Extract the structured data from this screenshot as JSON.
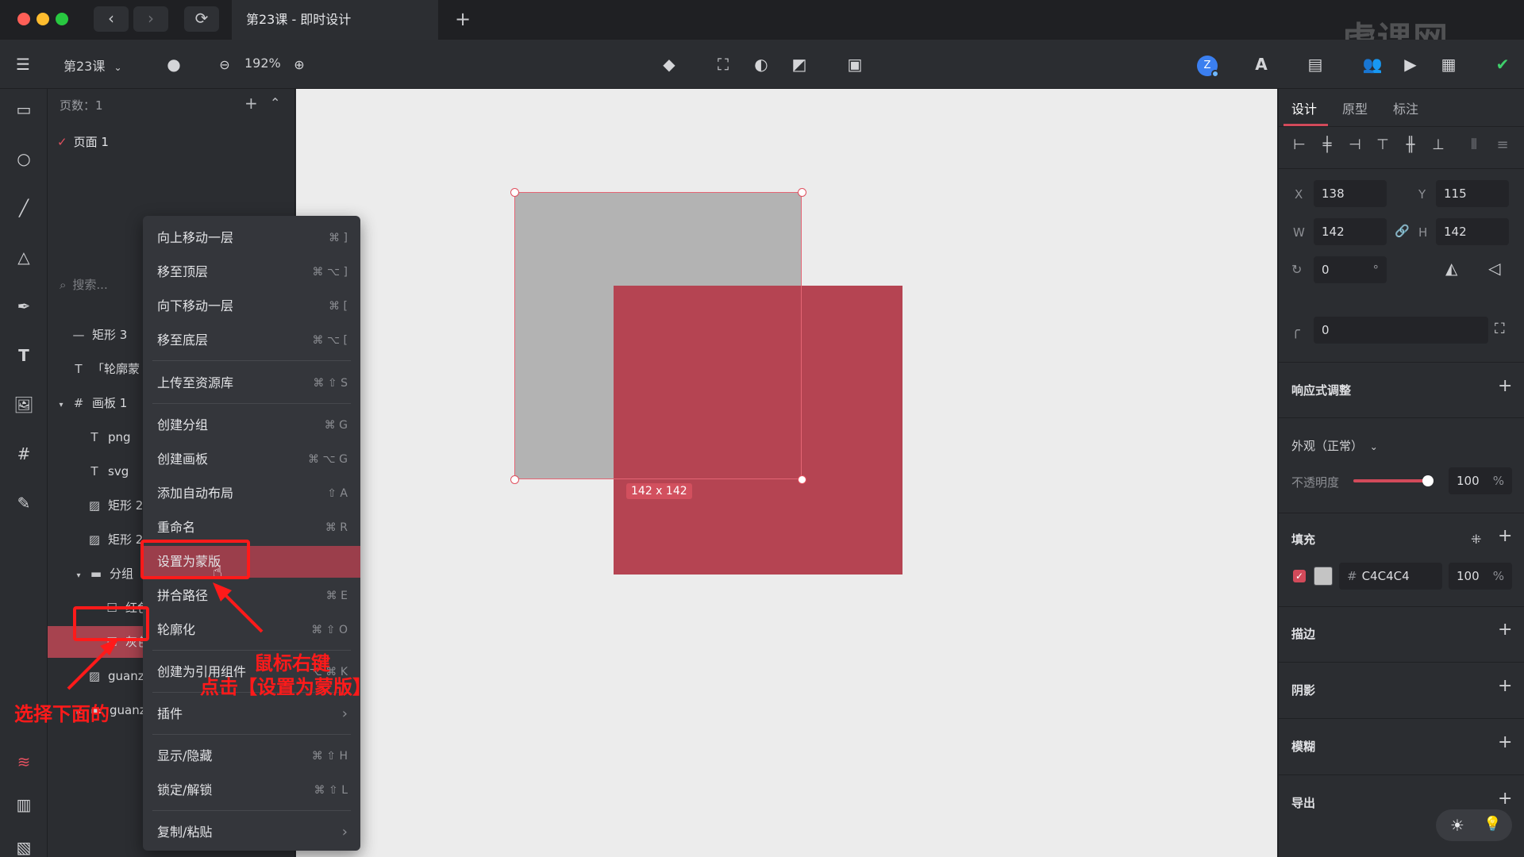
{
  "window": {
    "tab_title": "第23课 - 即时设计",
    "watermark": "虎课网"
  },
  "toolbar": {
    "project_name": "第23课",
    "zoom": "192%",
    "avatar_letter": "Z"
  },
  "pages": {
    "header": "页数：1",
    "items": [
      {
        "label": "页面 1",
        "selected": true
      }
    ]
  },
  "layers": {
    "search_placeholder": "搜索...",
    "rows": [
      {
        "label": "矩形 3"
      },
      {
        "label": "「轮廓蒙"
      },
      {
        "label": "画板 1"
      },
      {
        "label": "png"
      },
      {
        "label": "svg"
      },
      {
        "label": "矩形 2"
      },
      {
        "label": "矩形 2"
      },
      {
        "label": "分组"
      },
      {
        "label": "红色"
      },
      {
        "label": "灰色"
      },
      {
        "label": "guanz"
      },
      {
        "label": "guanz"
      }
    ]
  },
  "context_menu": {
    "items": [
      {
        "label": "向上移动一层",
        "shortcut": "⌘ ]"
      },
      {
        "label": "移至顶层",
        "shortcut": "⌘ ⌥ ]"
      },
      {
        "label": "向下移动一层",
        "shortcut": "⌘ ["
      },
      {
        "label": "移至底层",
        "shortcut": "⌘ ⌥ ["
      },
      {
        "label": "上传至资源库",
        "shortcut": "⌘ ⇧ S"
      },
      {
        "label": "创建分组",
        "shortcut": "⌘ G"
      },
      {
        "label": "创建画板",
        "shortcut": "⌘ ⌥ G"
      },
      {
        "label": "添加自动布局",
        "shortcut": "⇧ A"
      },
      {
        "label": "重命名",
        "shortcut": "⌘ R"
      },
      {
        "label": "设置为蒙版",
        "shortcut": ""
      },
      {
        "label": "拼合路径",
        "shortcut": "⌘ E"
      },
      {
        "label": "轮廓化",
        "shortcut": "⌘ ⇧ O"
      },
      {
        "label": "创建为引用组件",
        "shortcut": "⌥ ⌘ K"
      },
      {
        "label": "插件",
        "shortcut": "›"
      },
      {
        "label": "显示/隐藏",
        "shortcut": "⌘ ⇧ H"
      },
      {
        "label": "锁定/解锁",
        "shortcut": "⌘ ⇧ L"
      },
      {
        "label": "复制/粘贴",
        "shortcut": "›"
      }
    ]
  },
  "canvas": {
    "size_label": "142 x 142",
    "gray_color": "#b3b3b3",
    "red_color": "#b54452"
  },
  "design_panel": {
    "tabs": [
      "设计",
      "原型",
      "标注"
    ],
    "x_label": "X",
    "x_value": "138",
    "y_label": "Y",
    "y_value": "115",
    "w_label": "W",
    "w_value": "142",
    "h_label": "H",
    "h_value": "142",
    "rotation": "0",
    "rotation_unit": "°",
    "radius": "0",
    "responsive": "响应式调整",
    "appearance": "外观（正常）",
    "opacity_label": "不透明度",
    "opacity_value": "100",
    "opacity_unit": "%",
    "opacity_level": 1.0,
    "fill_title": "填充",
    "fill_hash": "#",
    "fill_hex": "C4C4C4",
    "fill_opacity": "100",
    "fill_unit": "%",
    "stroke": "描边",
    "shadow": "阴影",
    "blur": "模糊",
    "export": "导出"
  },
  "annotations": {
    "right_click": "鼠标右键",
    "click_set_mask": "点击【设置为蒙版】",
    "select_below": "选择下面的"
  }
}
